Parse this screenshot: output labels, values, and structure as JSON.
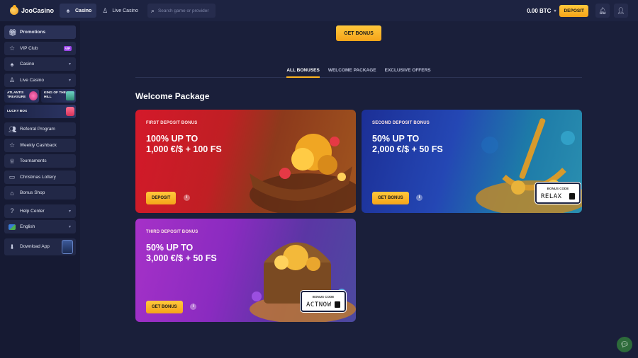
{
  "header": {
    "brand": "JooCasino",
    "tabs": [
      {
        "label": "Casino",
        "icon": "spade-icon",
        "active": true
      },
      {
        "label": "Live Casino",
        "icon": "dealer-icon",
        "active": false
      }
    ],
    "search_placeholder": "Search game or provider",
    "balance": "0.00 BTC",
    "deposit_label": "DEPOSIT"
  },
  "sidebar": {
    "items": [
      {
        "label": "Promotions",
        "icon": "gift-icon",
        "active": true
      },
      {
        "label": "VIP Club",
        "icon": "user-star-icon",
        "badge": "VIP"
      },
      {
        "label": "Casino",
        "icon": "spade-icon",
        "chevron": true
      },
      {
        "label": "Live Casino",
        "icon": "dealer-icon",
        "chevron": true
      }
    ],
    "tiles": [
      {
        "label": "ATLANTIS TREASURE"
      },
      {
        "label": "KING OF THE HILL"
      },
      {
        "label": "LUCKY BOX"
      }
    ],
    "items2": [
      {
        "label": "Referral Program",
        "icon": "people-icon"
      },
      {
        "label": "Weekly Cashback",
        "icon": "star-icon"
      },
      {
        "label": "Tournaments",
        "icon": "trophy-icon"
      },
      {
        "label": "Christmas Lottery",
        "icon": "ticket-icon"
      },
      {
        "label": "Bonus Shop",
        "icon": "shop-icon"
      }
    ],
    "help": {
      "label": "Help Center",
      "icon": "help-icon"
    },
    "language": {
      "label": "English",
      "icon": "flag-icon"
    },
    "download": {
      "label": "Download App",
      "icon": "download-icon"
    }
  },
  "main": {
    "get_bonus_label": "GET BONUS",
    "tabs": [
      {
        "label": "ALL BONUSES",
        "active": true
      },
      {
        "label": "WELCOME PACKAGE",
        "active": false
      },
      {
        "label": "EXCLUSIVE OFFERS",
        "active": false
      }
    ],
    "section_title": "Welcome Package",
    "cards": [
      {
        "kicker": "FIRST DEPOSIT BONUS",
        "line1": "100% UP TO",
        "line2": "1,000 €/$ + 100 FS",
        "cta": "DEPOSIT",
        "code_label": "",
        "code": ""
      },
      {
        "kicker": "SECOND DEPOSIT BONUS",
        "line1": "50% UP TO",
        "line2": "2,000 €/$ + 50 FS",
        "cta": "GET BONUS",
        "code_label": "BONUS CODE",
        "code": "RELAX"
      },
      {
        "kicker": "THIRD DEPOSIT BONUS",
        "line1": "50% UP TO",
        "line2": "3,000 €/$ + 50 FS",
        "cta": "GET BONUS",
        "code_label": "BONUS CODE",
        "code": "ACTNOW"
      }
    ]
  },
  "colors": {
    "accent": "#f5a41a",
    "background": "#1a1f3a",
    "sidebar": "#161a33"
  }
}
